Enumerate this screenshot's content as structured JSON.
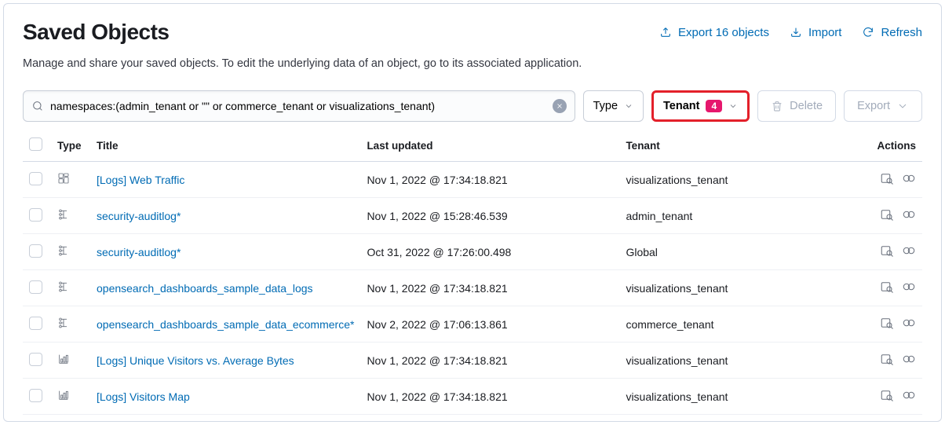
{
  "header": {
    "title": "Saved Objects",
    "export_label": "Export 16 objects",
    "import_label": "Import",
    "refresh_label": "Refresh"
  },
  "subtitle": "Manage and share your saved objects. To edit the underlying data of an object, go to its associated application.",
  "search": {
    "value": "namespaces:(admin_tenant or \"\" or commerce_tenant or visualizations_tenant)"
  },
  "filters": {
    "type_label": "Type",
    "tenant_label": "Tenant",
    "tenant_count": "4"
  },
  "buttons": {
    "delete_label": "Delete",
    "export_label": "Export"
  },
  "table": {
    "columns": {
      "type": "Type",
      "title": "Title",
      "last_updated": "Last updated",
      "tenant": "Tenant",
      "actions": "Actions"
    },
    "rows": [
      {
        "icon": "dashboard",
        "title": "[Logs] Web Traffic",
        "updated": "Nov 1, 2022 @ 17:34:18.821",
        "tenant": "visualizations_tenant"
      },
      {
        "icon": "index-pattern",
        "title": "security-auditlog*",
        "updated": "Nov 1, 2022 @ 15:28:46.539",
        "tenant": "admin_tenant"
      },
      {
        "icon": "index-pattern",
        "title": "security-auditlog*",
        "updated": "Oct 31, 2022 @ 17:26:00.498",
        "tenant": "Global"
      },
      {
        "icon": "index-pattern",
        "title": "opensearch_dashboards_sample_data_logs",
        "updated": "Nov 1, 2022 @ 17:34:18.821",
        "tenant": "visualizations_tenant"
      },
      {
        "icon": "index-pattern",
        "title": "opensearch_dashboards_sample_data_ecommerce*",
        "updated": "Nov 2, 2022 @ 17:06:13.861",
        "tenant": "commerce_tenant"
      },
      {
        "icon": "visualization",
        "title": "[Logs] Unique Visitors vs. Average Bytes",
        "updated": "Nov 1, 2022 @ 17:34:18.821",
        "tenant": "visualizations_tenant"
      },
      {
        "icon": "visualization",
        "title": "[Logs] Visitors Map",
        "updated": "Nov 1, 2022 @ 17:34:18.821",
        "tenant": "visualizations_tenant"
      }
    ]
  }
}
